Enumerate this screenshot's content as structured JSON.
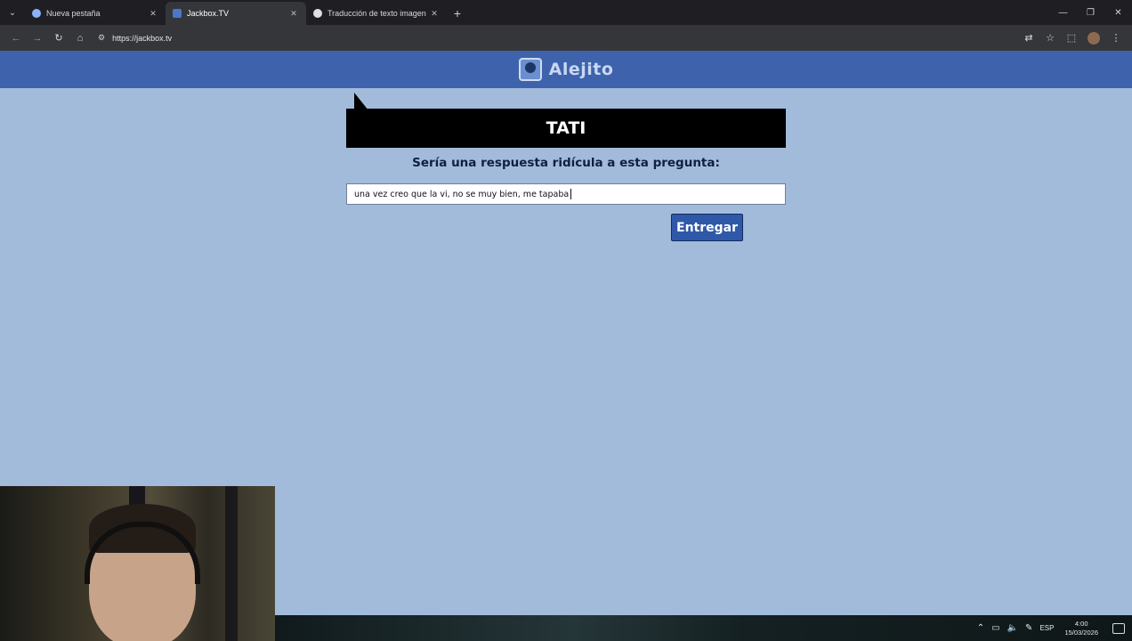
{
  "browser": {
    "tabs": [
      {
        "title": "Nueva pestaña",
        "active": false,
        "fav_color": "#8ab4f8"
      },
      {
        "title": "Jackbox.TV",
        "active": true,
        "fav_color": "#4a78c8"
      },
      {
        "title": "Traducción de texto imagen",
        "active": false,
        "fav_color": "#e0e0e0"
      }
    ],
    "url": "https://jackbox.tv"
  },
  "app": {
    "player_name": "Alejito"
  },
  "game": {
    "speaker": "TATI",
    "prompt": "Sería una respuesta ridícula a esta pregunta:",
    "answer_value": "una vez creo que la vi, no se muy bien, me tapaba",
    "submit_label": "Entregar"
  },
  "taskbar": {
    "language": "ESP",
    "time": "4:00",
    "date": "15/03/2026"
  },
  "colors": {
    "page_bg": "#a3bbdb",
    "header_bg": "#3e63ac",
    "button_bg": "#2f58a8"
  }
}
